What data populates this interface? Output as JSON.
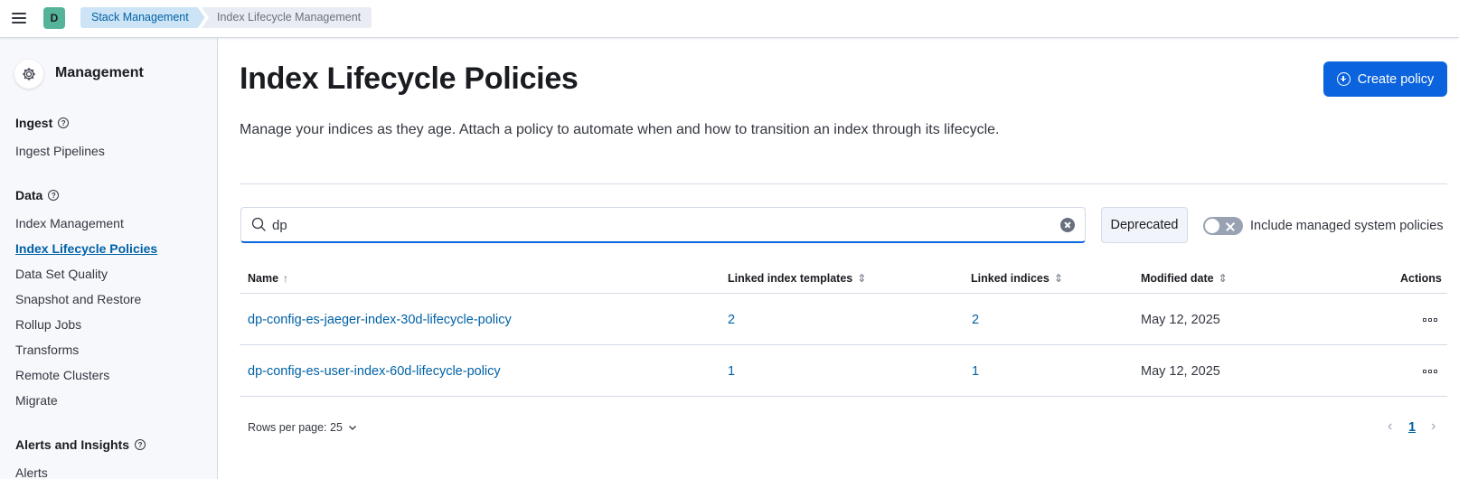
{
  "header": {
    "avatar_initial": "D",
    "breadcrumbs": [
      "Stack Management",
      "Index Lifecycle Management"
    ]
  },
  "sidebar": {
    "title": "Management",
    "groups": [
      {
        "title": "Ingest",
        "items": [
          "Ingest Pipelines"
        ]
      },
      {
        "title": "Data",
        "items": [
          "Index Management",
          "Index Lifecycle Policies",
          "Data Set Quality",
          "Snapshot and Restore",
          "Rollup Jobs",
          "Transforms",
          "Remote Clusters",
          "Migrate"
        ]
      },
      {
        "title": "Alerts and Insights",
        "items": [
          "Alerts"
        ]
      }
    ],
    "active_item": "Index Lifecycle Policies"
  },
  "main": {
    "title": "Index Lifecycle Policies",
    "create_button": "Create policy",
    "description": "Manage your indices as they age. Attach a policy to automate when and how to transition an index through its lifecycle.",
    "search_value": "dp",
    "deprecated_button": "Deprecated",
    "toggle_label": "Include managed system policies",
    "toggle_on": false
  },
  "table": {
    "columns": [
      "Name",
      "Linked index templates",
      "Linked indices",
      "Modified date",
      "Actions"
    ],
    "rows": [
      {
        "name": "dp-config-es-jaeger-index-30d-lifecycle-policy",
        "templates": "2",
        "indices": "2",
        "modified": "May 12, 2025"
      },
      {
        "name": "dp-config-es-user-index-60d-lifecycle-policy",
        "templates": "1",
        "indices": "1",
        "modified": "May 12, 2025"
      }
    ]
  },
  "pagination": {
    "rows_per_page": "Rows per page: 25",
    "current_page": "1"
  },
  "colors": {
    "primary": "#0b64dd",
    "link": "#0061a6",
    "avatar": "#54b399"
  }
}
